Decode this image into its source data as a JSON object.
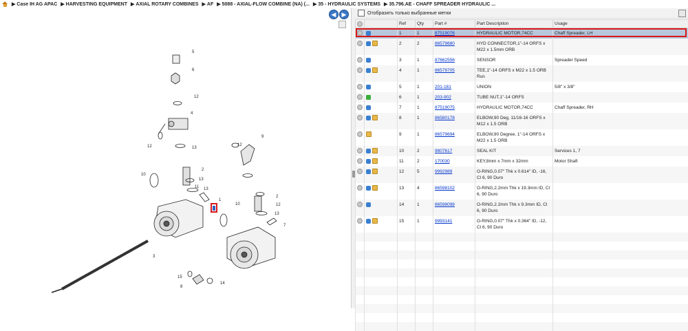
{
  "breadcrumb": [
    "Case IH AG APAC",
    "HARVESTING EQUIPMENT",
    "AXIAL ROTARY COMBINES",
    "AF",
    "5088 - AXIAL-FLOW COMBINE (NA) (...",
    "35 - HYDRAULIC SYSTEMS",
    "35.796.AE - CHAFF SPREADER HYDRAULIC ..."
  ],
  "filter": {
    "label": "Отобразить только выбранные метки"
  },
  "columns": {
    "ref": "Ref",
    "qty": "Qty",
    "part": "Part #",
    "desc": "Part Description",
    "usage": "Usage"
  },
  "rows": [
    {
      "ref": "1",
      "qty": "1",
      "part": "87519076",
      "desc": "HYDRAULIC MOTOR,74CC",
      "usage": "Chaff Spreader, LH"
    },
    {
      "ref": "2",
      "qty": "2",
      "part": "86579680",
      "desc": "HYD CONNECTOR,1\"-14 ORFS x M22 x 1.5mm ORB",
      "usage": ""
    },
    {
      "ref": "3",
      "qty": "1",
      "part": "87662556",
      "desc": "SENSOR",
      "usage": "Spreader Speed"
    },
    {
      "ref": "4",
      "qty": "1",
      "part": "86579705",
      "desc": "TEE,1\"-14 ORFS x M22 x 1.5 ORB Run",
      "usage": ""
    },
    {
      "ref": "5",
      "qty": "1",
      "part": "201-161",
      "desc": "UNION",
      "usage": "5/8\" x 3/8\""
    },
    {
      "ref": "6",
      "qty": "1",
      "part": "203-902",
      "desc": "TUBE NUT,1\"-14 ORFS",
      "usage": ""
    },
    {
      "ref": "7",
      "qty": "1",
      "part": "87519075",
      "desc": "HYDRAULIC MOTOR,74CC",
      "usage": "Chaff Spreader, RH"
    },
    {
      "ref": "8",
      "qty": "1",
      "part": "86580178",
      "desc": "ELBOW,90 Deg, 11/16-16 ORFS x M12 x 1.5 ORB",
      "usage": ""
    },
    {
      "ref": "9",
      "qty": "1",
      "part": "86579694",
      "desc": "ELBOW,90 Degree, 1\"-14 ORFS x M22 x 1.5 ORB",
      "usage": ""
    },
    {
      "ref": "10",
      "qty": "2",
      "part": "9807617",
      "desc": "SEAL KIT",
      "usage": "Services 1, 7"
    },
    {
      "ref": "11",
      "qty": "2",
      "part": "170030",
      "desc": "KEY,8mm x 7mm x 32mm",
      "usage": "Motor Shaft"
    },
    {
      "ref": "12",
      "qty": "5",
      "part": "9992989",
      "desc": "O-RING,0.07\" Thk x 0.614\" ID, -16, Cl 6, 90 Duro",
      "usage": ""
    },
    {
      "ref": "13",
      "qty": "4",
      "part": "86598102",
      "desc": "O-RING,2.2mm Thk x 19.3mm ID, Cl 6, 90 Duro",
      "usage": ""
    },
    {
      "ref": "14",
      "qty": "1",
      "part": "86598098",
      "desc": "O-RING,2.2mm Thk x 9.3mm ID, Cl 6, 90 Duro",
      "usage": ""
    },
    {
      "ref": "15",
      "qty": "1",
      "part": "9993141",
      "desc": "O-RING,0.07\" Thk x 0.364\" ID, -12, Cl 6, 90 Duro",
      "usage": ""
    }
  ],
  "row_icons": [
    [
      "grey",
      "blue"
    ],
    [
      "grey",
      "blue",
      "box"
    ],
    [
      "grey",
      "blue"
    ],
    [
      "grey",
      "blue",
      "box"
    ],
    [
      "grey",
      "blue"
    ],
    [
      "grey",
      "green"
    ],
    [
      "grey",
      "blue"
    ],
    [
      "grey",
      "blue",
      "box"
    ],
    [
      "grey",
      "box"
    ],
    [
      "grey",
      "blue",
      "box"
    ],
    [
      "grey",
      "blue",
      "box"
    ],
    [
      "grey",
      "blue",
      "box"
    ],
    [
      "grey",
      "blue",
      "box"
    ],
    [
      "grey",
      "blue"
    ],
    [
      "grey",
      "blue",
      "box"
    ]
  ],
  "diagram_callouts": [
    "5",
    "6",
    "12",
    "4",
    "12",
    "13",
    "9",
    "12",
    "2",
    "10",
    "13",
    "13",
    "11",
    "2",
    "12",
    "13",
    "1",
    "10",
    "7",
    "3",
    "15",
    "8",
    "14"
  ],
  "colors": {
    "selection": "#b8c7dc",
    "highlight_border": "#d81818",
    "link": "#0033cc"
  }
}
